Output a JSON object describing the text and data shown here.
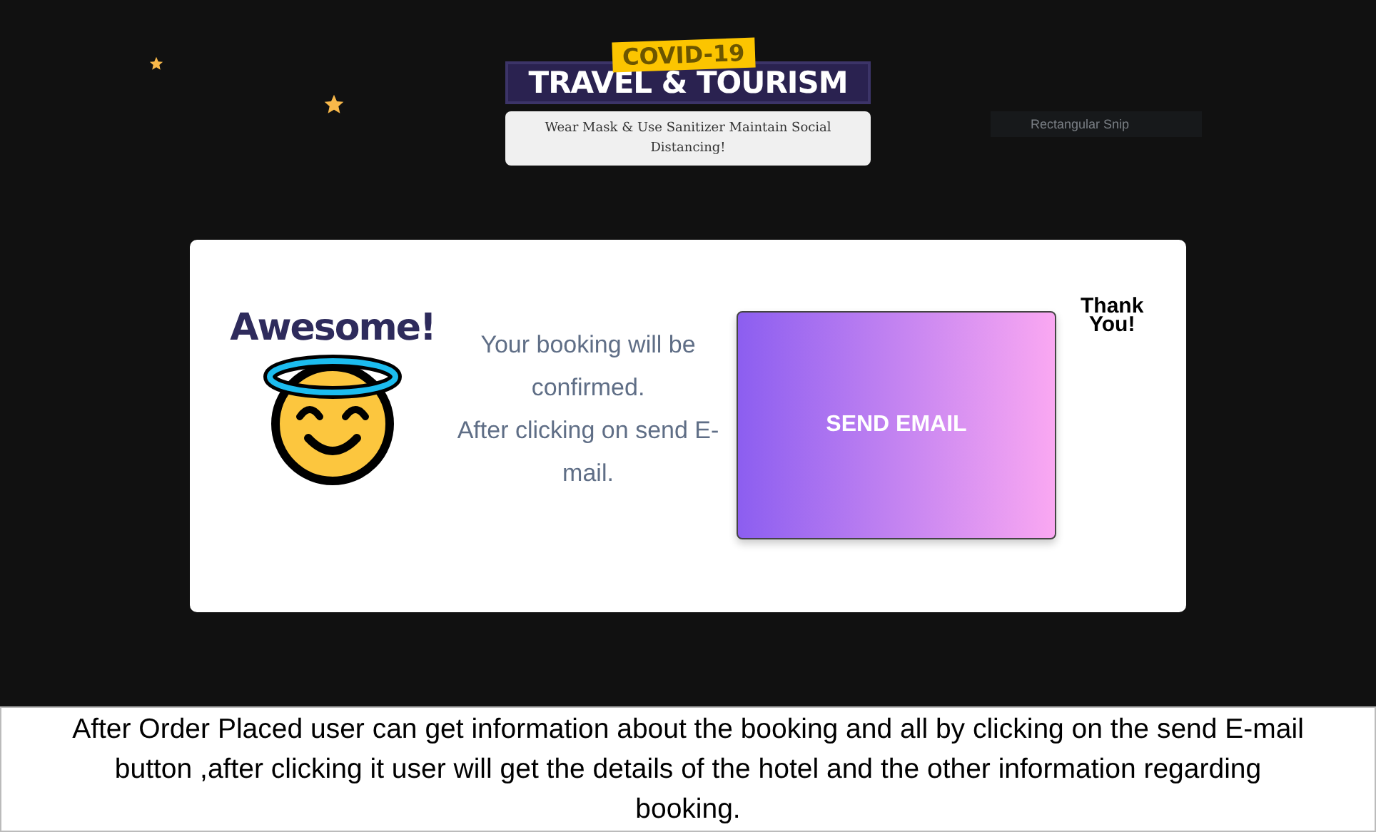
{
  "header": {
    "badge": "COVID-19",
    "title": "TRAVEL & TOURISM",
    "tooltip": "Wear Mask & Use Sanitizer Maintain Social Distancing!"
  },
  "snip": {
    "label": "Rectangular Snip"
  },
  "card": {
    "heading": "Awesome!",
    "message": [
      "Your booking will be confirmed.",
      "After clicking on send E-mail."
    ],
    "button": "SEND EMAIL",
    "thanks": [
      "Thank",
      "You!"
    ]
  },
  "caption": "After Order Placed user can get information about the booking and all by clicking on the send E-mail button ,after clicking it user will get the details of the hotel and the other information regarding  booking."
}
